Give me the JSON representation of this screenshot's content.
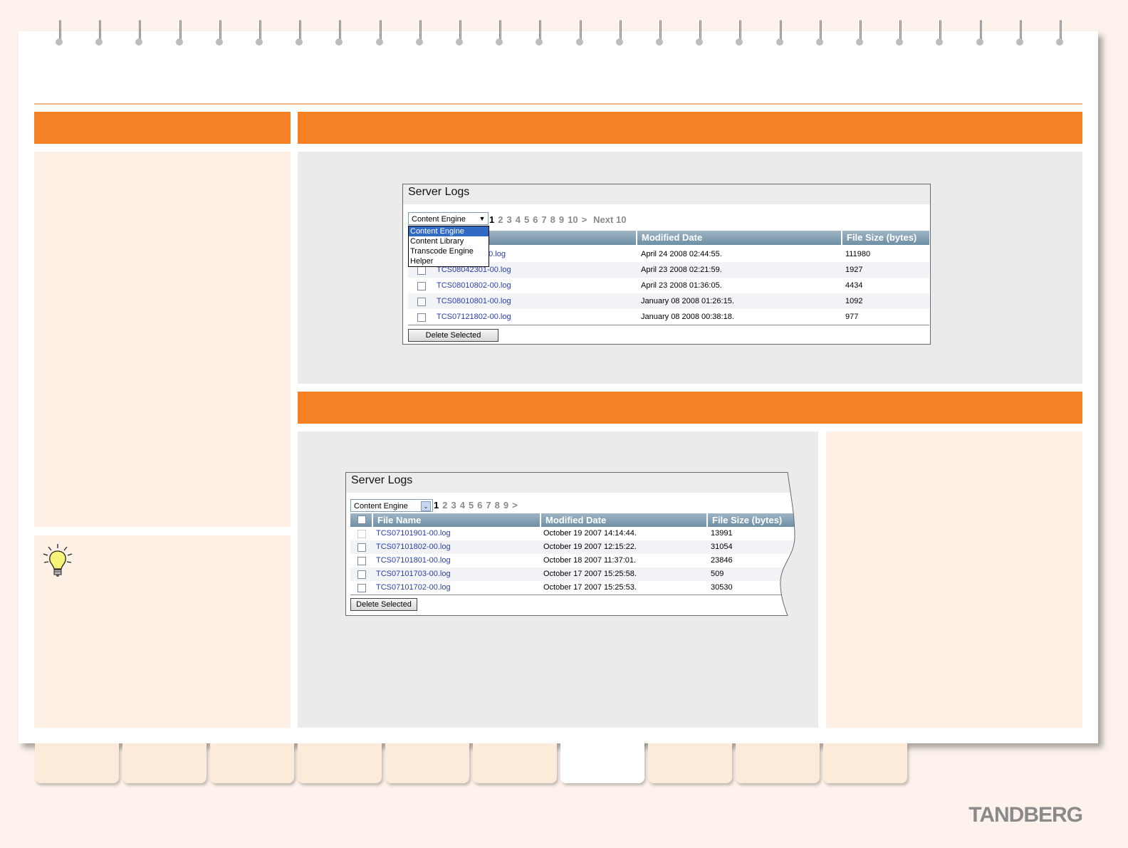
{
  "top_panel": {
    "title": "Server Logs",
    "select_value": "Content Engine",
    "dropdown_options": [
      "Content Engine",
      "Content Library",
      "Transcode Engine",
      "Helper"
    ],
    "pages": [
      "1",
      "2",
      "3",
      "4",
      "5",
      "6",
      "7",
      "8",
      "9",
      "10",
      ">",
      "Next 10"
    ],
    "columns": [
      "Modified Date",
      "File Size (bytes)"
    ],
    "rows": [
      {
        "file": "TCS08042401-00.log",
        "visible_file": "00.log",
        "date": "April 24 2008 02:44:55.",
        "size": "111980"
      },
      {
        "file": "TCS08042301-00.log",
        "date": "April 23 2008 02:21:59.",
        "size": "1927"
      },
      {
        "file": "TCS08010802-00.log",
        "date": "April 23 2008 01:36:05.",
        "size": "4434"
      },
      {
        "file": "TCS08010801-00.log",
        "date": "January 08 2008 01:26:15.",
        "size": "1092"
      },
      {
        "file": "TCS07121802-00.log",
        "date": "January 08 2008 00:38:18.",
        "size": "977"
      }
    ],
    "delete_label": "Delete Selected"
  },
  "bottom_panel": {
    "title": "Server Logs",
    "select_value": "Content Engine",
    "pages": [
      "1",
      "2",
      "3",
      "4",
      "5",
      "6",
      "7",
      "8",
      "9",
      ">"
    ],
    "columns": [
      "File Name",
      "Modified Date",
      "File Size (bytes)"
    ],
    "rows": [
      {
        "file": "TCS07101901-00.log",
        "date": "October 19 2007 14:14:44.",
        "size": "13991"
      },
      {
        "file": "TCS07101802-00.log",
        "date": "October 19 2007 12:15:22.",
        "size": "31054"
      },
      {
        "file": "TCS07101801-00.log",
        "date": "October 18 2007 11:37:01.",
        "size": "23846"
      },
      {
        "file": "TCS07101703-00.log",
        "date": "October 17 2007 15:25:58.",
        "size": "509"
      },
      {
        "file": "TCS07101702-00.log",
        "date": "October 17 2007 15:25:53.",
        "size": "30530"
      }
    ],
    "delete_label": "Delete Selected"
  },
  "brand": "TANDBERG",
  "colors": {
    "accent": "#f48124",
    "panel_peach": "#fef0e4",
    "panel_gray": "#ebebeb",
    "link": "#2a3ea8"
  }
}
